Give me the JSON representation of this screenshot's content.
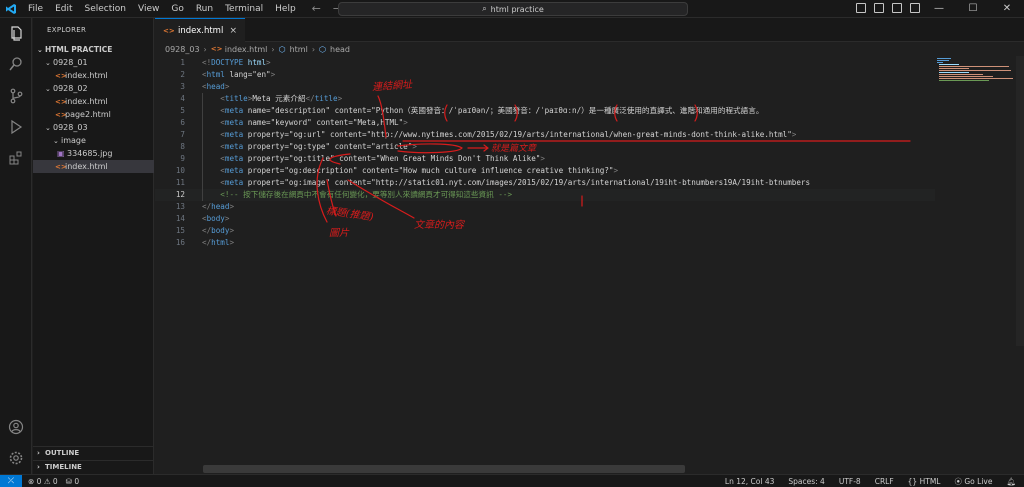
{
  "menu": [
    "File",
    "Edit",
    "Selection",
    "View",
    "Go",
    "Run",
    "Terminal",
    "Help"
  ],
  "command_center": {
    "label": "html practice"
  },
  "window_controls": {
    "minimize": "—",
    "maximize": "☐",
    "close": "✕"
  },
  "sidebar": {
    "title": "EXPLORER",
    "root": "HTML PRACTICE",
    "tree": [
      {
        "label": "0928_01",
        "kind": "folder",
        "depth": 1
      },
      {
        "label": "index.html",
        "kind": "html",
        "depth": 2
      },
      {
        "label": "0928_02",
        "kind": "folder",
        "depth": 1
      },
      {
        "label": "index.html",
        "kind": "html",
        "depth": 2
      },
      {
        "label": "page2.html",
        "kind": "html",
        "depth": 2
      },
      {
        "label": "0928_03",
        "kind": "folder",
        "depth": 1
      },
      {
        "label": "image",
        "kind": "folder",
        "depth": 2
      },
      {
        "label": "334685.jpg",
        "kind": "image",
        "depth": 3
      },
      {
        "label": "index.html",
        "kind": "html",
        "depth": 2,
        "selected": true
      }
    ],
    "outline": "OUTLINE",
    "timeline": "TIMELINE"
  },
  "tab": {
    "label": "index.html",
    "close": "×"
  },
  "breadcrumb": {
    "folder": "0928_03",
    "file": "index.html",
    "html": "html",
    "head": "head"
  },
  "code_lines": [
    {
      "n": "1",
      "text": "<!DOCTYPE html>"
    },
    {
      "n": "2",
      "text": "<html lang=\"en\">"
    },
    {
      "n": "3",
      "text": "<head>"
    },
    {
      "n": "4",
      "text": "    <title>Meta 元素介紹</title>"
    },
    {
      "n": "5",
      "text": "    <meta name=\"description\" content=\"Python（英國發音：/ˈpaɪθən/；美國發音：/ˈpaɪθɑːn/）是一種廣泛使用的直譯式、進階和通用的程式語言。"
    },
    {
      "n": "6",
      "text": "    <meta name=\"keyword\" content=\"Meta,HTML\">"
    },
    {
      "n": "7",
      "text": "    <meta property=\"og:url\" content=\"http://www.nytimes.com/2015/02/19/arts/international/when-great-minds-dont-think-alike.html\">"
    },
    {
      "n": "8",
      "text": "    <meta property=\"og:type\" content=\"article\">"
    },
    {
      "n": "9",
      "text": "    <meta property=\"og:title\" content=\"When Great Minds Don't Think Alike\">"
    },
    {
      "n": "10",
      "text": "    <meta propert=\"og:description\" content=\"How much culture influence creative thinking?\">"
    },
    {
      "n": "11",
      "text": "    <meta propert=\"og:image\" content=\"http://static01.nyt.com/images/2015/02/19/arts/international/19iht-btnumbers19A/19iht-btnumbers"
    },
    {
      "n": "12",
      "text": "    <!-- 按下儲存後在網頁中不會有任何變化，要等別人來讀網頁才可得知這些資訊 -->"
    },
    {
      "n": "13",
      "text": "</head>"
    },
    {
      "n": "14",
      "text": "<body>"
    },
    {
      "n": "15",
      "text": "</body>"
    },
    {
      "n": "16",
      "text": "</html>"
    }
  ],
  "annotations": {
    "url": "連結網址",
    "type": "就是篇文章",
    "title": "標題(推題)",
    "image": "圖片",
    "desc": "文章的內容"
  },
  "status": {
    "errors": "⊗ 0 ⚠ 0",
    "ports": "⛁ 0",
    "position": "Ln 12, Col 43",
    "spaces": "Spaces: 4",
    "encoding": "UTF-8",
    "eol": "CRLF",
    "language": "HTML",
    "golive": "Go Live"
  },
  "colors": {
    "accent": "#0078d4",
    "annotation": "#d71c1c"
  }
}
